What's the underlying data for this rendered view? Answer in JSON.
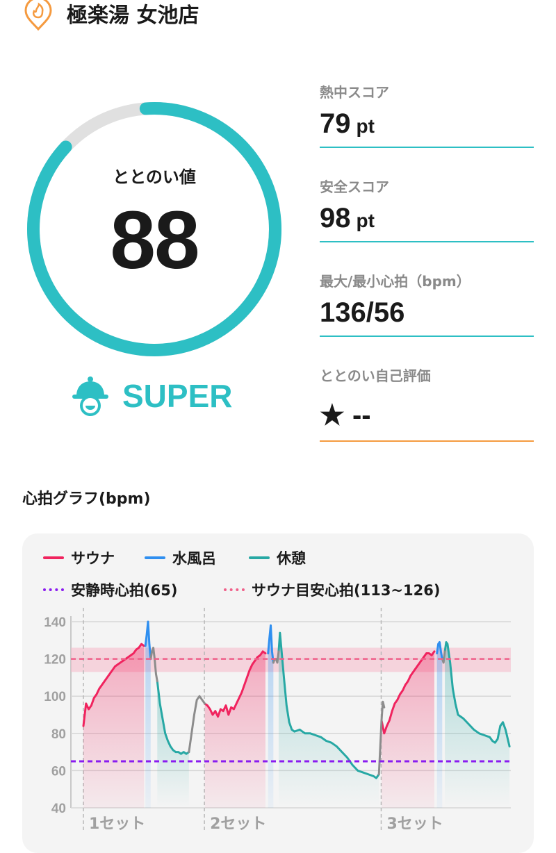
{
  "header": {
    "title": "極楽湯 女池店",
    "icon": "flame-pin-icon"
  },
  "score": {
    "label": "ととのい値",
    "value": "88",
    "ratio": 0.88,
    "rank": "SUPER",
    "rank_icon": "bell-mascot-icon"
  },
  "stats": [
    {
      "label": "熱中スコア",
      "value": "79",
      "unit": "pt"
    },
    {
      "label": "安全スコア",
      "value": "98",
      "unit": "pt"
    },
    {
      "label": "最大/最小心拍（bpm）",
      "value": "136/56",
      "unit": ""
    },
    {
      "label": "ととのい自己評価",
      "value": "★ --",
      "unit": ""
    }
  ],
  "graph": {
    "title": "心拍グラフ(bpm)",
    "legend": {
      "sauna": "サウナ",
      "cold": "水風呂",
      "rest": "休憩",
      "resting_hr": "安静時心拍(65)",
      "target_hr": "サウナ目安心拍(113~126)"
    },
    "colors": {
      "sauna": "#f0235e",
      "cold": "#2f8ff0",
      "rest": "#27a8a4",
      "resting": "#8a1cf0",
      "target": "#f0608a",
      "transition": "#8c8c8c"
    }
  },
  "chart_data": {
    "type": "line",
    "y_ticks": [
      "140",
      "120",
      "100",
      "80",
      "60",
      "40"
    ],
    "ylim": [
      40,
      140
    ],
    "grid": true,
    "reference_lines": [
      {
        "name": "安静時心拍(65)",
        "value": 65
      },
      {
        "name": "サウナ目安心拍(113~126)",
        "value": 120,
        "band": [
          113,
          126
        ]
      }
    ],
    "sets": [
      {
        "label": "1セット"
      },
      {
        "label": "2セット"
      },
      {
        "label": "3セット"
      }
    ],
    "series": [
      {
        "name": "サウナ",
        "segments": [
          [
            [
              0,
              84
            ],
            [
              1,
              96
            ],
            [
              2,
              93
            ],
            [
              3,
              95
            ],
            [
              4,
              99
            ],
            [
              5,
              101
            ],
            [
              6,
              104
            ],
            [
              7,
              106
            ],
            [
              8,
              108
            ],
            [
              9,
              110
            ],
            [
              10,
              112
            ],
            [
              11,
              114
            ],
            [
              12,
              116
            ],
            [
              13,
              117
            ],
            [
              14,
              118
            ],
            [
              15,
              119
            ],
            [
              16,
              120
            ],
            [
              17,
              121
            ],
            [
              18,
              122
            ],
            [
              19,
              123
            ],
            [
              20,
              125
            ],
            [
              21,
              126
            ],
            [
              22,
              128
            ],
            [
              23,
              127
            ]
          ],
          [
            [
              46,
              96
            ],
            [
              47,
              95
            ],
            [
              48,
              93
            ],
            [
              49,
              90
            ],
            [
              50,
              92
            ],
            [
              51,
              89
            ],
            [
              52,
              93
            ],
            [
              53,
              92
            ],
            [
              54,
              95
            ],
            [
              55,
              90
            ],
            [
              56,
              94
            ],
            [
              57,
              93
            ],
            [
              58,
              96
            ],
            [
              59,
              99
            ],
            [
              60,
              102
            ],
            [
              61,
              106
            ],
            [
              62,
              110
            ],
            [
              63,
              114
            ],
            [
              64,
              117
            ],
            [
              65,
              119
            ],
            [
              66,
              121
            ],
            [
              67,
              122
            ],
            [
              68,
              124
            ],
            [
              69,
              123
            ]
          ],
          [
            [
              113,
              87
            ],
            [
              114,
              80
            ],
            [
              115,
              84
            ],
            [
              116,
              87
            ],
            [
              117,
              92
            ],
            [
              118,
              96
            ],
            [
              119,
              98
            ],
            [
              120,
              101
            ],
            [
              121,
              103
            ],
            [
              122,
              106
            ],
            [
              123,
              108
            ],
            [
              124,
              111
            ],
            [
              125,
              113
            ],
            [
              126,
              115
            ],
            [
              127,
              117
            ],
            [
              128,
              119
            ],
            [
              129,
              121
            ],
            [
              130,
              123
            ],
            [
              131,
              123
            ],
            [
              132,
              122
            ],
            [
              133,
              124
            ]
          ]
        ]
      },
      {
        "name": "水風呂",
        "segments": [
          [
            [
              23.5,
              127
            ],
            [
              24,
              133
            ],
            [
              24.5,
              140
            ],
            [
              25,
              128
            ],
            [
              25.5,
              120
            ]
          ],
          [
            [
              70,
              123
            ],
            [
              70.5,
              131
            ],
            [
              71,
              138
            ],
            [
              71.5,
              124
            ],
            [
              72,
              118
            ]
          ],
          [
            [
              134,
              123
            ],
            [
              134.5,
              128
            ],
            [
              135,
              129
            ],
            [
              135.5,
              124
            ],
            [
              136,
              120
            ]
          ]
        ]
      },
      {
        "name": "休憩",
        "segments": [
          [
            [
              28,
              108
            ],
            [
              29,
              96
            ],
            [
              30,
              88
            ],
            [
              31,
              80
            ],
            [
              32,
              76
            ],
            [
              33,
              73
            ],
            [
              34,
              71
            ],
            [
              35,
              70
            ],
            [
              36,
              70
            ],
            [
              37,
              69
            ],
            [
              38,
              70
            ],
            [
              39,
              69
            ],
            [
              40,
              70
            ]
          ],
          [
            [
              74,
              124
            ],
            [
              74.5,
              134
            ],
            [
              75,
              126
            ],
            [
              76,
              110
            ],
            [
              77,
              95
            ],
            [
              78,
              86
            ],
            [
              79,
              82
            ],
            [
              80,
              81
            ],
            [
              82,
              82
            ],
            [
              84,
              80
            ],
            [
              86,
              80
            ],
            [
              88,
              79
            ],
            [
              90,
              78
            ],
            [
              92,
              76
            ],
            [
              94,
              75
            ],
            [
              96,
              73
            ],
            [
              98,
              70
            ],
            [
              100,
              67
            ],
            [
              102,
              63
            ],
            [
              104,
              60
            ],
            [
              106,
              59
            ],
            [
              108,
              58
            ],
            [
              110,
              57
            ],
            [
              111,
              56
            ],
            [
              112,
              58
            ]
          ],
          [
            [
              137,
              124
            ],
            [
              137.5,
              129
            ],
            [
              138,
              128
            ],
            [
              139,
              118
            ],
            [
              140,
              104
            ],
            [
              141,
              96
            ],
            [
              142,
              90
            ],
            [
              144,
              88
            ],
            [
              146,
              85
            ],
            [
              148,
              82
            ],
            [
              150,
              80
            ],
            [
              152,
              79
            ],
            [
              154,
              78
            ],
            [
              155,
              76
            ],
            [
              156,
              75
            ],
            [
              157,
              77
            ],
            [
              158,
              84
            ],
            [
              159,
              86
            ],
            [
              160,
              82
            ],
            [
              161,
              76
            ],
            [
              161.5,
              73
            ]
          ]
        ]
      },
      {
        "name": "移行",
        "segments": [
          [
            [
              25.5,
              120
            ],
            [
              26,
              124
            ],
            [
              26.5,
              126
            ],
            [
              27,
              120
            ],
            [
              27.5,
              112
            ],
            [
              28,
              108
            ]
          ],
          [
            [
              40,
              70
            ],
            [
              41,
              80
            ],
            [
              42,
              90
            ],
            [
              43,
              98
            ],
            [
              44,
              100
            ],
            [
              45,
              98
            ],
            [
              46,
              96
            ]
          ],
          [
            [
              72,
              118
            ],
            [
              72.5,
              120
            ],
            [
              73,
              120
            ],
            [
              73.5,
              118
            ],
            [
              74,
              124
            ]
          ],
          [
            [
              112,
              58
            ],
            [
              112.5,
              72
            ],
            [
              113,
              87
            ],
            [
              113.5,
              97
            ],
            [
              114,
              94
            ]
          ],
          [
            [
              136,
              120
            ],
            [
              136.5,
              118
            ],
            [
              137,
              124
            ]
          ]
        ]
      }
    ]
  }
}
